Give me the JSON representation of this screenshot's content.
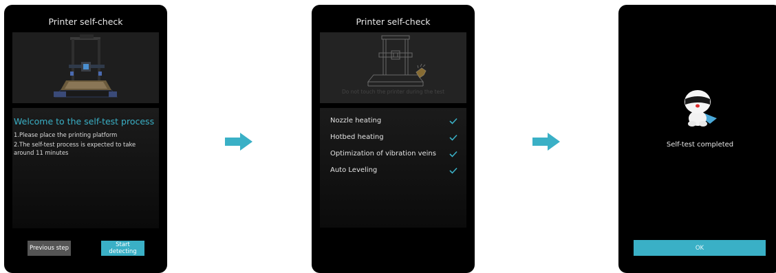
{
  "screen1": {
    "title": "Printer self-check",
    "welcome": "Welcome to the self-test process",
    "line1": "1.Please place the printing platform",
    "line2": "2.The self-test process is expected to take around 11 minutes",
    "prev_label": "Previous step",
    "start_label": "Start detecting"
  },
  "screen2": {
    "title": "Printer self-check",
    "notice": "Do not touch the printer during the test",
    "items": [
      {
        "label": "Nozzle heating"
      },
      {
        "label": "Hotbed heating"
      },
      {
        "label": "Optimization of vibration veins"
      },
      {
        "label": "Auto Leveling"
      }
    ]
  },
  "screen3": {
    "status": "Self-test completed",
    "ok_label": "OK"
  },
  "colors": {
    "accent": "#3ab0c6",
    "arrow": "#3ab0c6",
    "check": "#3ab0c6"
  },
  "icons": [
    "printer-illustration",
    "printer-outline-illustration",
    "check-icon",
    "mascot-illustration",
    "arrow-right-icon"
  ]
}
